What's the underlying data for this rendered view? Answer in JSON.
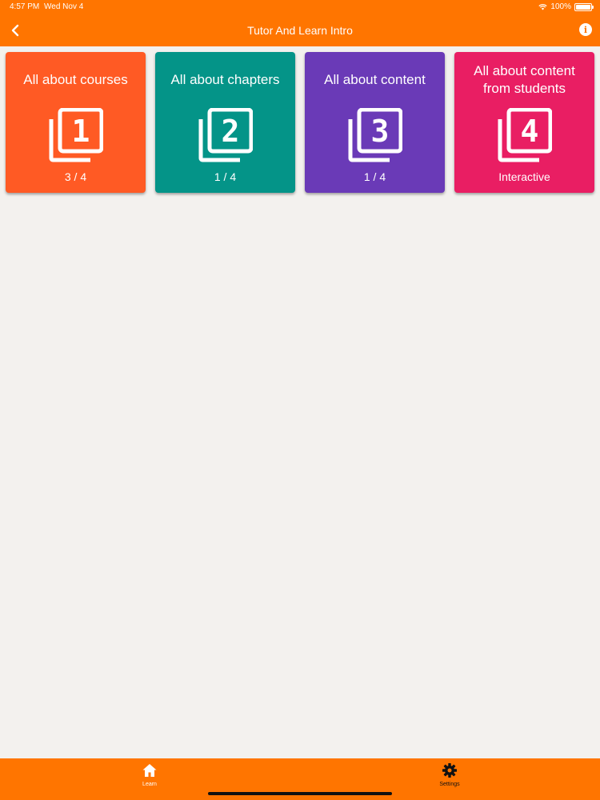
{
  "status_bar": {
    "time": "4:57 PM",
    "date": "Wed Nov 4",
    "battery": "100%"
  },
  "header": {
    "title": "Tutor And Learn Intro",
    "back_icon": "chevron-left-icon",
    "info_icon": "info-icon"
  },
  "cards": [
    {
      "title": "All about courses",
      "number": "1",
      "footer": "3 / 4",
      "color": "#ff5a24"
    },
    {
      "title": "All about chapters",
      "number": "2",
      "footer": "1 / 4",
      "color": "#049488"
    },
    {
      "title": "All about content",
      "number": "3",
      "footer": "1 / 4",
      "color": "#6a3ab7"
    },
    {
      "title": "All about content from students",
      "number": "4",
      "footer": "Interactive",
      "color": "#e91e63"
    }
  ],
  "bottom_nav": {
    "tabs": [
      {
        "label": "Learn",
        "icon": "home-icon",
        "active": true
      },
      {
        "label": "Settings",
        "icon": "gear-icon",
        "active": false
      }
    ]
  },
  "colors": {
    "accent": "#ff7500",
    "background": "#f3f1ee"
  }
}
